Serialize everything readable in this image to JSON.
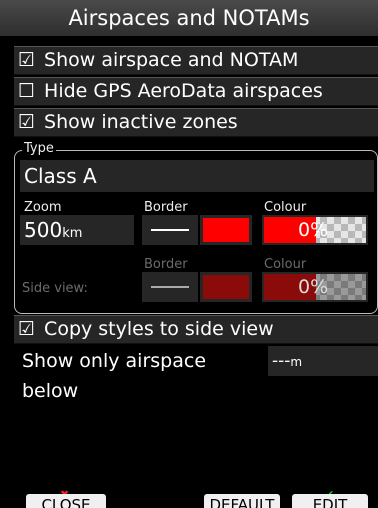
{
  "header": {
    "title": "Airspaces and NOTAMs"
  },
  "options": [
    {
      "checkbox": "☑",
      "label": "Show airspace and NOTAM"
    },
    {
      "checkbox": "☐",
      "label": "Hide GPS AeroData airspaces"
    },
    {
      "checkbox": "☑",
      "label": "Show inactive zones"
    }
  ],
  "type_group": {
    "legend": "Type",
    "selected_class": "Class A",
    "zoom_label": "Zoom",
    "zoom_value": "500",
    "zoom_unit": "km",
    "border_label": "Border",
    "colour_label": "Colour",
    "colour_percent": "0%",
    "border_color": "#ff0000",
    "side_view_label": "Side view:",
    "side_border_label": "Border",
    "side_colour_label": "Colour",
    "side_colour_percent": "0%",
    "side_border_color": "#8b0a0a"
  },
  "copy_styles": {
    "checkbox": "☑",
    "label": "Copy styles to side view"
  },
  "show_below": {
    "label": "Show only airspace below",
    "value": "---",
    "unit": "m"
  },
  "buttons": {
    "close": "CLOSE",
    "default": "DEFAULT",
    "edit": "EDIT"
  },
  "colors": {
    "close_icon": "#ff2020",
    "edit_icon": "#22c022"
  }
}
